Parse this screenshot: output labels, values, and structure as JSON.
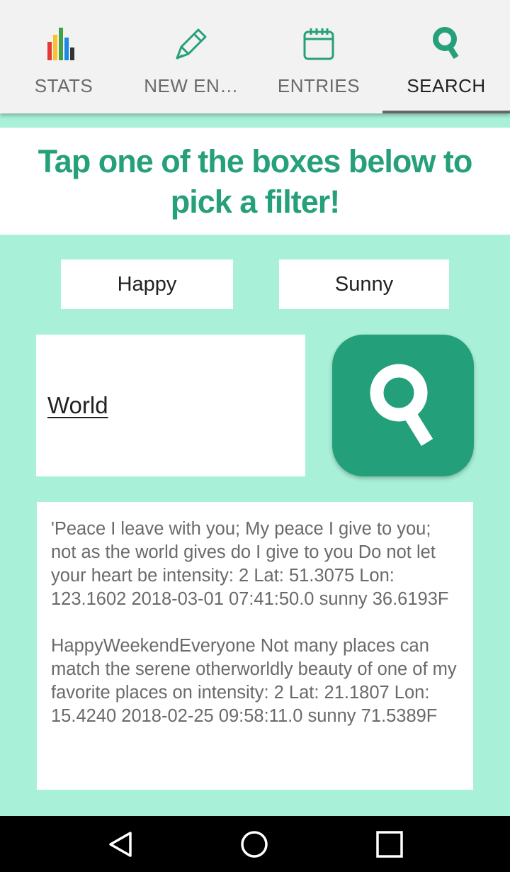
{
  "tabs": [
    {
      "label": "STATS",
      "icon": "bar-chart-icon",
      "active": false
    },
    {
      "label": "NEW EN…",
      "icon": "pencil-icon",
      "active": false
    },
    {
      "label": "ENTRIES",
      "icon": "calendar-icon",
      "active": false
    },
    {
      "label": "SEARCH",
      "icon": "search-icon",
      "active": true
    }
  ],
  "banner": {
    "title": "Tap one of the boxes below to pick a filter!"
  },
  "filters": {
    "mood": "Happy",
    "weather": "Sunny"
  },
  "search": {
    "value": "World",
    "button_icon": "search-icon"
  },
  "results": [
    {
      "text": "'Peace I leave with you; My peace I give to you; not as the world gives do I give to you Do not let your heart be   intensity: 2   Lat: 51.3075   Lon: 123.1602   2018-03-01 07:41:50.0   sunny   36.6193F"
    },
    {
      "text": "HappyWeekendEveryone Not many places can match the  serene otherworldly  beauty of one of my  favorite places on   intensity: 2   Lat: 21.1807   Lon: 15.4240   2018-02-25 09:58:11.0   sunny   71.5389F"
    }
  ],
  "colors": {
    "accent": "#26a07a",
    "background": "#a8f0d8",
    "tabbar": "#f2f2f2"
  },
  "navbar": {
    "buttons": [
      "back-icon",
      "home-icon",
      "recents-icon"
    ]
  }
}
